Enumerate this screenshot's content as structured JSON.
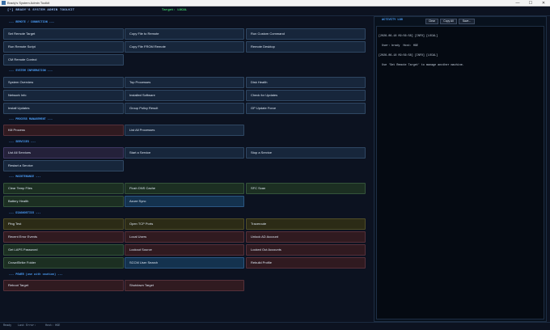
{
  "window": {
    "title": "Brady's System Admin Toolkit",
    "controls": {
      "minimize": "—",
      "maximize": "☐",
      "close": "✕"
    }
  },
  "header": {
    "app_title": "[*] BRADY'S SYSTEM ADMIN TOOLKIT",
    "target": "Target: LOCAL"
  },
  "sections": {
    "remote": "--- REMOTE / CONNECTION ---",
    "sysinfo": "--- SYSTEM INFORMATION ---",
    "process": "--- PROCESS MANAGEMENT ---",
    "services": "--- SERVICES ---",
    "maintenance": "--- MAINTENANCE ---",
    "diagnostics": "--- DIAGNOSTICS ---",
    "power": "--- POWER (use with caution) ---"
  },
  "buttons": {
    "set_remote_target": "Set Remote Target",
    "copy_file_to_remote": "Copy File to Remote",
    "run_custom_command": "Run Custom Command",
    "run_remote_script": "Run Remote Script",
    "copy_file_from_remote": "Copy File FROM Remote",
    "remote_desktop": "Remote Desktop",
    "cm_remote_control": "CM Remote Control",
    "system_overview": "System Overview",
    "top_processes": "Top Processes",
    "disk_health": "Disk Health",
    "network_info": "Network Info",
    "installed_software": "Installed Software",
    "check_for_updates": "Check for Updates",
    "install_updates": "Install Updates",
    "group_policy_result": "Group Policy Result",
    "gp_update_force": "GP Update Force",
    "kill_process": "Kill Process",
    "list_all_processes": "List All Processes",
    "list_all_services": "List All Services",
    "start_a_service": "Start a Service",
    "stop_a_service": "Stop a Service",
    "restart_a_service": "Restart a Service",
    "clear_temp_files": "Clear Temp Files",
    "flush_dns_cache": "Flush DNS Cache",
    "sfc_scan": "SFC Scan",
    "battery_health": "Battery Health",
    "azure_sync": "Azure Sync",
    "ping_test": "Ping Test",
    "open_tcp_ports": "Open TCP Ports",
    "traceroute": "Traceroute",
    "recent_error_events": "Recent Error Events",
    "local_users": "Local Users",
    "unlock_ad_account": "Unlock AD Account",
    "get_laps_password": "Get LAPS Password",
    "lockout_source": "Lockout Source",
    "locked_out_accounts": "Locked Out Accounts",
    "crowdstrike_folder": "CrowdStrike Folder",
    "sccm_user_search": "SCCM User Search",
    "rebuild_profile": "Rebuild Profile",
    "reboot_target": "Reboot Target",
    "shutdown_target": "Shutdown Target"
  },
  "activity_log": {
    "title": "ACTIVITY LOG",
    "clear": "Clear",
    "copy_all": "Copy All",
    "save": "Save...",
    "lines": [
      "[2026-06-18 09:56:58] [INFO] [LOCAL]",
      "  User: brady  Host: HGE",
      "[2026-06-18 09:56:58] [INFO] [LOCAL]",
      "  Use 'Set Remote Target' to manage another machine."
    ]
  },
  "status": {
    "ready": "Ready",
    "last_error": "Last Error:",
    "host": "Host: HGE"
  },
  "colors": {
    "background": "#0c1220",
    "accent_blue": "#4ea3ff",
    "target_green": "#3ecf6a",
    "default_button": "#17263b",
    "red_button": "#301a20",
    "green_button": "#1c2f22",
    "blue_button": "#14324e",
    "yellow_button": "#2c2b16",
    "purple_button": "#24213a"
  }
}
